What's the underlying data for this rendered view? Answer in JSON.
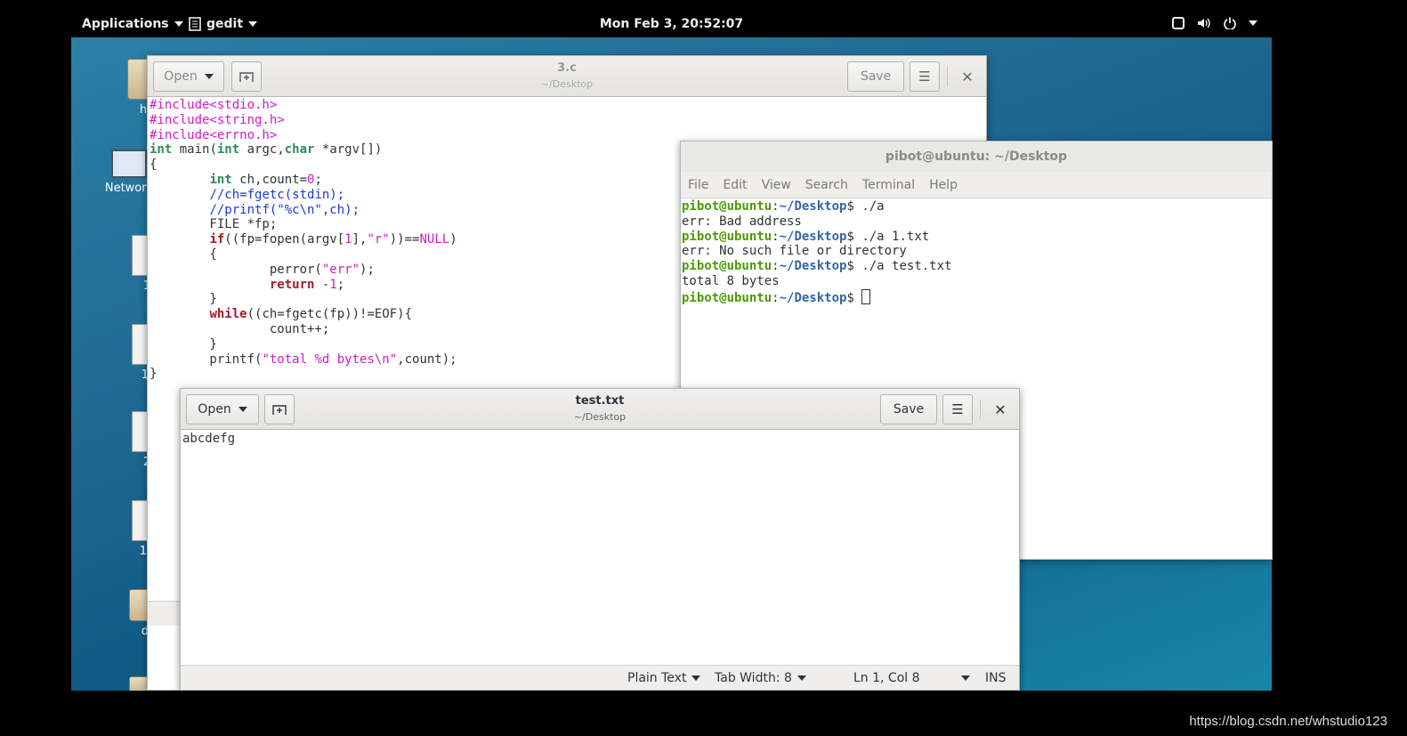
{
  "topbar": {
    "applications_label": "Applications",
    "app_label": "gedit",
    "clock": "Mon Feb  3, 20:52:07"
  },
  "desktop": {
    "icons": [
      {
        "label": "ho"
      },
      {
        "label": "Network"
      },
      {
        "label": "1"
      },
      {
        "label": "1."
      },
      {
        "label": "2"
      },
      {
        "label": "12"
      },
      {
        "label": "dd"
      }
    ]
  },
  "editor_back": {
    "open_label": "Open",
    "save_label": "Save",
    "title": "3.c",
    "subtitle": "~/Desktop"
  },
  "terminal": {
    "title": "pibot@ubuntu: ~/Desktop",
    "menu": [
      "File",
      "Edit",
      "View",
      "Search",
      "Terminal",
      "Help"
    ],
    "prompt_user": "pibot@ubuntu",
    "prompt_path": "~/Desktop",
    "commands": [
      "./a",
      "./a 1.txt",
      "./a test.txt"
    ],
    "outputs": [
      "err: Bad address",
      "err: No such file or directory",
      "total 8 bytes"
    ]
  },
  "editor_front": {
    "open_label": "Open",
    "save_label": "Save",
    "title": "test.txt",
    "subtitle": "~/Desktop",
    "content": "abcdefg",
    "status": {
      "language": "Plain Text",
      "tab_width": "Tab Width: 8",
      "position": "Ln 1, Col 8",
      "mode": "INS"
    }
  },
  "watermark": "https://blog.csdn.net/whstudio123"
}
